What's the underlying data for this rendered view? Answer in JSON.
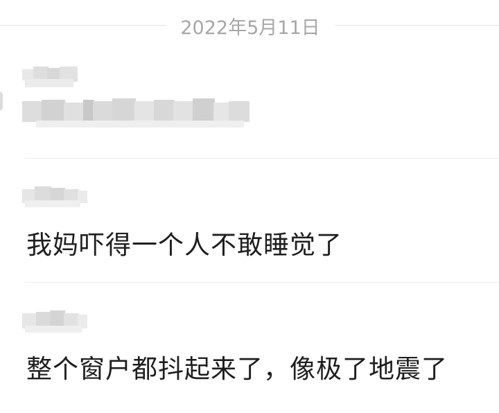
{
  "date_separator": "2022年5月11日",
  "messages": [
    {
      "author": "",
      "text": "",
      "obscured": true
    },
    {
      "author": "",
      "text": "我妈吓得一个人不敢睡觉了",
      "obscured_author": true
    },
    {
      "author": "",
      "text": "整个窗户都抖起来了，像极了地震了",
      "obscured_author": true
    }
  ],
  "colors": {
    "background": "#ffffff",
    "date_text": "#a6a6a6",
    "divider": "#ececec",
    "message_text": "#1e1e1e",
    "blur": "#e3e3e3"
  }
}
